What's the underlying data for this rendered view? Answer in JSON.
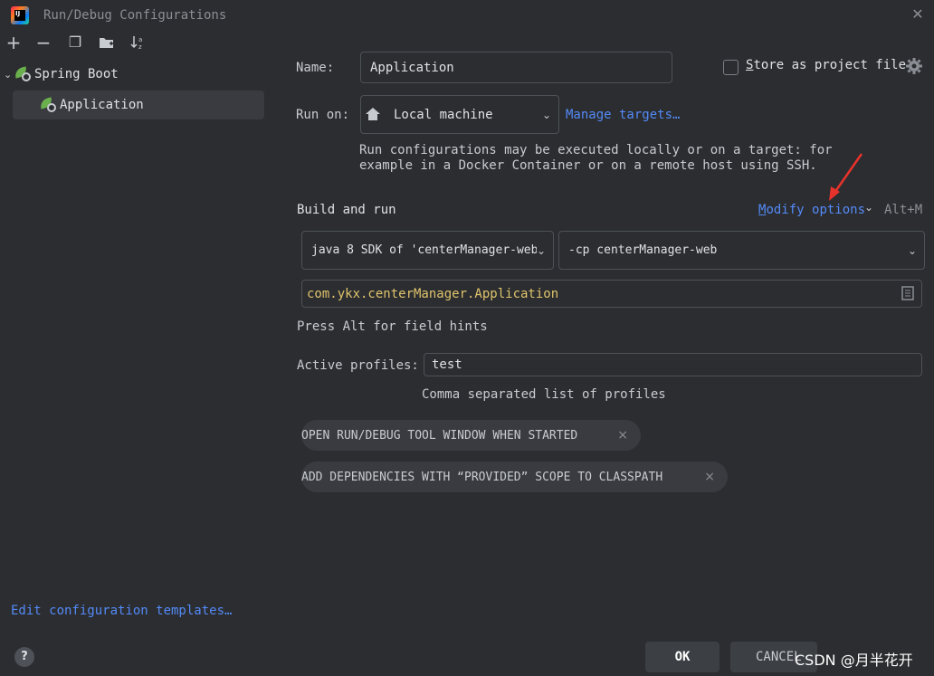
{
  "window": {
    "title": "Run/Debug Configurations",
    "close_glyph": "✕"
  },
  "toolbar": {
    "add_glyph": "+",
    "remove_glyph": "−",
    "copy_glyph": "❐",
    "folder_glyph": "▣",
    "sort_glyph": "↓a z"
  },
  "tree": {
    "group_label": "Spring Boot",
    "group_chevron": "⌄",
    "items": [
      {
        "label": "Application",
        "selected": true
      }
    ]
  },
  "form": {
    "name_label": "Name:",
    "name_value": "Application",
    "store_label": "Store as project file",
    "run_on_label": "Run on:",
    "run_on_value": "Local machine",
    "manage_targets": "Manage targets…",
    "run_on_hint_line1": "Run configurations may be executed locally or on a target: for",
    "run_on_hint_line2": "example in a Docker Container or on a remote host using SSH.",
    "build_run_title": "Build and run",
    "modify_options": "Modify options",
    "modify_shortcut": "Alt+M",
    "sdk_value": "java 8 SDK of 'centerManager-web'",
    "classpath_value": "-cp centerManager-web",
    "main_class_value": "com.ykx.centerManager.Application",
    "field_hints": "Press Alt for field hints",
    "profiles_label": "Active profiles:",
    "profiles_value": "test",
    "profiles_hint": "Comma separated list of profiles",
    "chips": [
      {
        "label": "OPEN RUN/DEBUG TOOL WINDOW WHEN STARTED"
      },
      {
        "label": "ADD DEPENDENCIES WITH “PROVIDED” SCOPE TO CLASSPATH"
      }
    ],
    "chip_close": "×"
  },
  "footer": {
    "edit_templates": "Edit configuration templates…",
    "help_glyph": "?",
    "ok_label": "OK",
    "cancel_label": "CANCEL",
    "watermark": "CSDN @月半花开"
  },
  "colors": {
    "background": "#2b2d30",
    "link": "#548af7",
    "main_class_text": "#e0c46c",
    "annotation_arrow": "#e8322c"
  }
}
